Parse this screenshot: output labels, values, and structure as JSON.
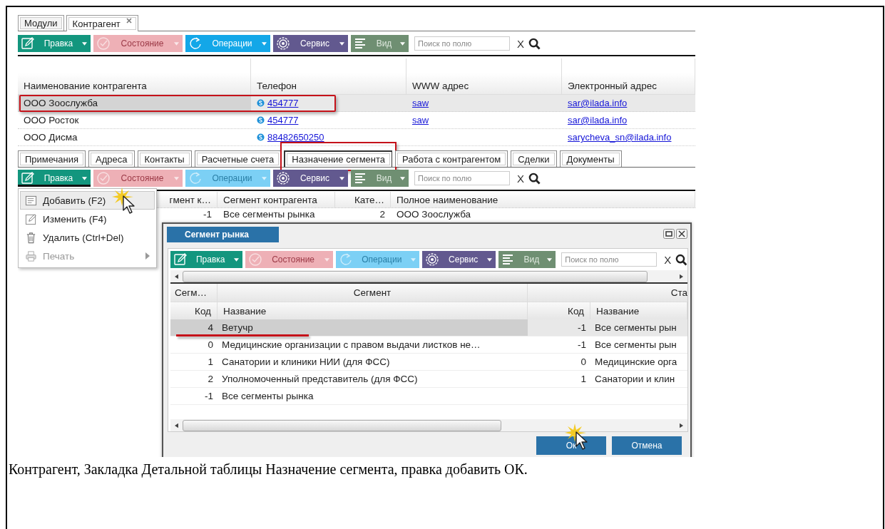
{
  "tabs": [
    {
      "label": "Модули",
      "selected": false,
      "closable": false
    },
    {
      "label": "Контрагент",
      "selected": true,
      "closable": true
    }
  ],
  "toolbar": {
    "buttons": [
      {
        "kind": "edit",
        "label": "Правка",
        "disabled": false
      },
      {
        "kind": "state",
        "label": "Состояние",
        "disabled": true
      },
      {
        "kind": "operations",
        "label": "Операции",
        "disabled": false
      },
      {
        "kind": "service",
        "label": "Сервис",
        "disabled": false
      },
      {
        "kind": "view",
        "label": "Вид",
        "disabled": false
      }
    ],
    "search": {
      "placeholder": "Поиск по полю"
    },
    "clear": "X"
  },
  "main_table": {
    "columns": [
      "Наименование контрагента",
      "Телефон",
      "WWW адрес",
      "Электронный адрес"
    ],
    "rows": [
      {
        "selected": true,
        "marked": true,
        "name": "ООО Зоослужба",
        "phone": "454777",
        "www": "saw",
        "email": "sar@ilada.info"
      },
      {
        "selected": false,
        "marked": false,
        "name": "ООО Росток",
        "phone": "454777",
        "www": "saw",
        "email": "sar@ilada.info"
      },
      {
        "selected": false,
        "marked": false,
        "name": "ООО Дисма",
        "phone": "88482650250",
        "email": "sarycheva_sn@ilada.info"
      }
    ]
  },
  "detail_tabs": [
    {
      "label": "Примечания",
      "selected": false,
      "marked": false
    },
    {
      "label": "Адреса",
      "selected": false,
      "marked": false
    },
    {
      "label": "Контакты",
      "selected": false,
      "marked": false
    },
    {
      "label": "Расчетные счета",
      "selected": false,
      "marked": false
    },
    {
      "label": "Назначение сегмента",
      "selected": true,
      "marked": true
    },
    {
      "label": "Работа с контрагентом",
      "selected": false,
      "marked": false
    },
    {
      "label": "Сделки",
      "selected": false,
      "marked": false
    },
    {
      "label": "Документы",
      "selected": false,
      "marked": false
    }
  ],
  "detail_toolbar": {
    "buttons": [
      {
        "kind": "edit",
        "label": "Правка",
        "disabled": false,
        "open": true
      },
      {
        "kind": "state",
        "label": "Состояние",
        "disabled": true,
        "open": false
      },
      {
        "kind": "operations",
        "label": "Операции",
        "disabled": true,
        "open": false
      },
      {
        "kind": "service",
        "label": "Сервис",
        "disabled": false,
        "open": false
      },
      {
        "kind": "view",
        "label": "Вид",
        "disabled": false,
        "open": false
      }
    ],
    "search": {
      "placeholder": "Поиск по полю"
    },
    "clear": "X"
  },
  "detail_table": {
    "columns": [
      {
        "label": "гмент к…",
        "numeric": true
      },
      {
        "label": "Сегмент контрагента",
        "numeric": false
      },
      {
        "label": "Кате…",
        "numeric": true
      },
      {
        "label": "Полное наименование",
        "numeric": false
      }
    ],
    "rows": [
      {
        "cells": [
          "-1",
          "Все сегменты рынка",
          "2",
          "ООО Зоослужба"
        ]
      }
    ]
  },
  "menu": {
    "items": [
      {
        "kind": "add",
        "label": "Добавить (F2)",
        "selected": true,
        "disabled": false,
        "submenu": false,
        "cursor": true
      },
      {
        "kind": "edit",
        "label": "Изменить (F4)",
        "selected": false,
        "disabled": false,
        "submenu": false,
        "cursor": false
      },
      {
        "kind": "delete",
        "label": "Удалить (Ctrl+Del)",
        "selected": false,
        "disabled": false,
        "submenu": false,
        "cursor": false
      },
      {
        "kind": "print",
        "label": "Печать",
        "selected": false,
        "disabled": true,
        "submenu": true,
        "cursor": false
      }
    ]
  },
  "dialog": {
    "title": "Сегмент рынка",
    "toolbar": {
      "buttons": [
        {
          "kind": "edit",
          "label": "Правка",
          "disabled": false
        },
        {
          "kind": "state",
          "label": "Состояние",
          "disabled": true
        },
        {
          "kind": "operations",
          "label": "Операции",
          "disabled": true
        },
        {
          "kind": "service",
          "label": "Сервис",
          "disabled": false
        },
        {
          "kind": "view",
          "label": "Вид",
          "disabled": false
        }
      ],
      "search": {
        "placeholder": "Поиск по полю"
      },
      "clear": "X"
    },
    "table": {
      "groups": [
        {
          "label": "Сегм…",
          "columns": [
            {
              "label": "Код",
              "numeric": true
            }
          ]
        },
        {
          "label": "Сегмент",
          "columns": [
            {
              "label": "Название",
              "numeric": false
            }
          ]
        },
        {
          "label": "Ста",
          "columns": [
            {
              "label": "Код",
              "numeric": true
            },
            {
              "label": "Название",
              "numeric": false
            }
          ]
        }
      ],
      "rows": [
        {
          "selected": true,
          "underlined": true,
          "cells": [
            "4",
            "Ветучр",
            "-1",
            "Все сегменты рын"
          ]
        },
        {
          "selected": false,
          "underlined": false,
          "cells": [
            "0",
            "Медицинские организации с правом выдачи листков не…",
            "-1",
            "Все сегменты рын"
          ]
        },
        {
          "selected": false,
          "underlined": false,
          "cells": [
            "1",
            "Санатории и клиники НИИ (для ФСС)",
            "0",
            "Медицинские орга"
          ]
        },
        {
          "selected": false,
          "underlined": false,
          "cells": [
            "2",
            "Уполномоченный представитель (для ФСС)",
            "1",
            "Санатории и клин"
          ]
        },
        {
          "selected": false,
          "underlined": false,
          "cells": [
            "-1",
            "Все сегменты рынка"
          ]
        }
      ]
    },
    "buttons": [
      {
        "label": "Ок",
        "cursor": true
      },
      {
        "label": "Отмена",
        "cursor": false
      }
    ]
  },
  "caption": "Контрагент, Закладка Детальной таблицы Назначение сегмента, правка добавить ОК."
}
